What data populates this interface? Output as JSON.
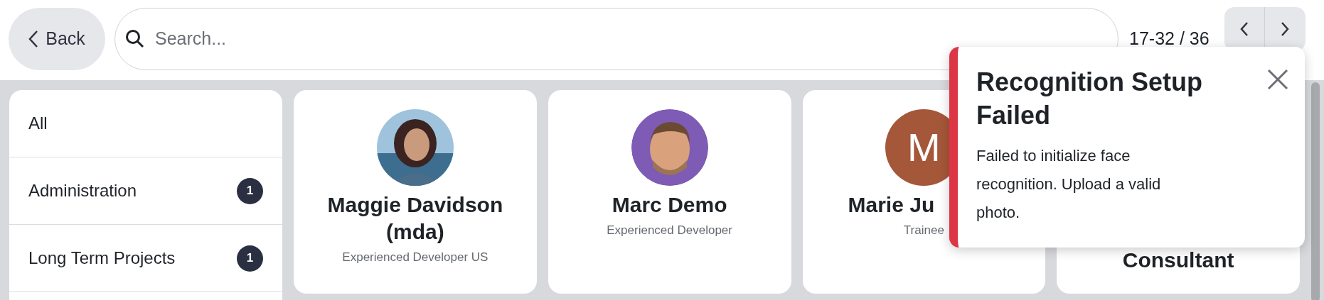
{
  "back_button": {
    "label": "Back"
  },
  "search": {
    "placeholder": "Search..."
  },
  "pager": {
    "range": "17-32 / 36"
  },
  "sidebar": {
    "items": [
      {
        "label": "All"
      },
      {
        "label": "Administration",
        "count": "1"
      },
      {
        "label": "Long Term Projects",
        "count": "1"
      }
    ]
  },
  "cards": [
    {
      "name": "Maggie Davidson (mda)",
      "job": "Experienced Developer US"
    },
    {
      "kind": "avatar",
      "name": "Marc Demo",
      "job": "Experienced Developer"
    },
    {
      "kind": "initial",
      "initial": "M",
      "color": "#a5573a",
      "name": "Marie Ju",
      "job": "Trainee"
    },
    {
      "kind": "hidden",
      "name": "Consultant"
    }
  ],
  "toast": {
    "title": "Recognition Setup Failed",
    "message": "Failed to initialize face recognition. Upload a valid photo."
  }
}
